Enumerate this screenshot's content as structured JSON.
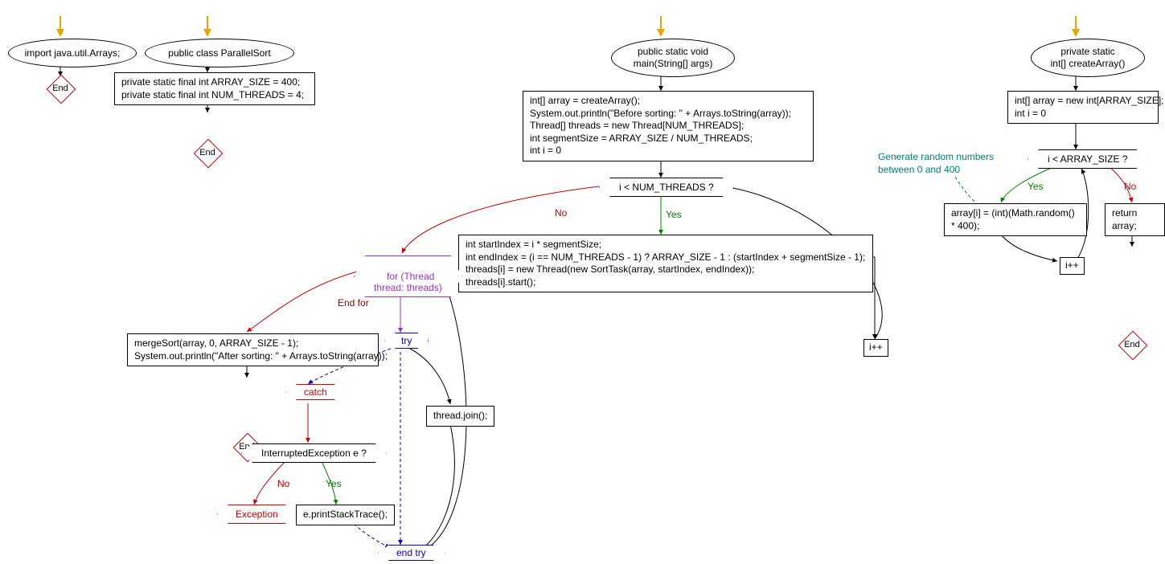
{
  "labels": {
    "end": "End",
    "yes": "Yes",
    "no": "No",
    "end_for": "End for"
  },
  "group1": {
    "import_stmt": "import java.util.Arrays;"
  },
  "group2": {
    "class_decl": "public class ParallelSort",
    "fields": "private static final int ARRAY_SIZE = 400;\nprivate static final int NUM_THREADS = 4;"
  },
  "main": {
    "signature": "public static void\nmain(String[] args)",
    "init": "int[] array = createArray();\nSystem.out.println(\"Before sorting: \" + Arrays.toString(array));\nThread[] threads = new Thread[NUM_THREADS];\nint segmentSize = ARRAY_SIZE / NUM_THREADS;\nint i = 0",
    "cond": "i < NUM_THREADS ?",
    "loop_body": "int startIndex = i * segmentSize;\nint endIndex = (i == NUM_THREADS - 1) ? ARRAY_SIZE - 1 : (startIndex + segmentSize - 1);\nthreads[i] = new Thread(new SortTask(array, startIndex, endIndex));\nthreads[i].start();",
    "incr": "i++",
    "for_each": "for (Thread\nthread: threads)",
    "try": "try",
    "join": "thread.join();",
    "catch": "catch",
    "catch_cond": "InterruptedException e ?",
    "catch_body": "e.printStackTrace();",
    "exception": "Exception",
    "end_try": "end try",
    "after_for": "mergeSort(array, 0, ARRAY_SIZE - 1);\nSystem.out.println(\"After sorting: \" + Arrays.toString(array));"
  },
  "createArray": {
    "signature": "private static\nint[] createArray()",
    "init": "int[] array = new int[ARRAY_SIZE];\nint i = 0",
    "cond": "i < ARRAY_SIZE ?",
    "body": "array[i] = (int)(Math.random()\n* 400);",
    "incr": "i++",
    "ret": "return array;",
    "comment": "Generate random numbers\nbetween 0 and 400"
  }
}
